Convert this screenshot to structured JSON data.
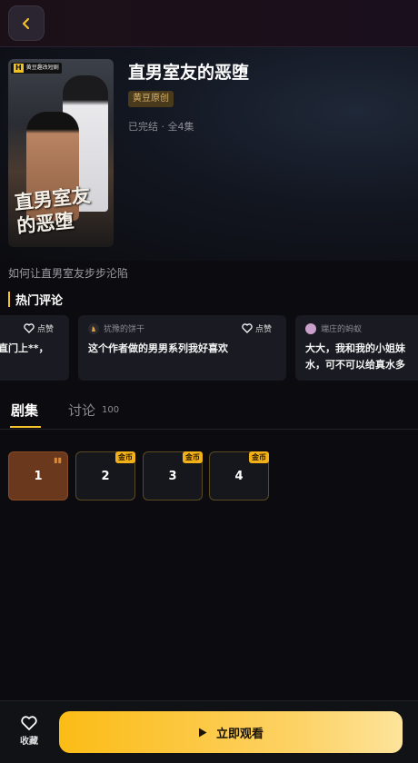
{
  "drama": {
    "title": "直男室友的恶堕",
    "tag": "黄豆原创",
    "status": "已完结 · 全4集",
    "description": "如何让直男室友步步沦陷",
    "poster": {
      "badge_letter": "H",
      "badge_text": "黄豆趣改短剧",
      "title_line1": "直男室友",
      "title_line2": "的恶堕"
    }
  },
  "comments_section": {
    "title": "热门评论",
    "comments": [
      {
        "user": "",
        "text": "直门上**，",
        "like_label": "点赞"
      },
      {
        "user": "犹豫的饼干",
        "text": "这个作者做的男男系列我好喜欢",
        "like_label": "点赞"
      },
      {
        "user": "端庄的蚂蚁",
        "text_line1": "大大，我和我的小姐妹",
        "text_line2": "水，可不可以给真水多"
      }
    ]
  },
  "tabs": {
    "episodes_label": "剧集",
    "discuss_label": "讨论",
    "discuss_count": "100"
  },
  "episodes": [
    {
      "number": "1",
      "coin": "",
      "playing": true
    },
    {
      "number": "2",
      "coin": "金币",
      "playing": false
    },
    {
      "number": "3",
      "coin": "金币",
      "playing": false
    },
    {
      "number": "4",
      "coin": "金币",
      "playing": false
    }
  ],
  "bottom": {
    "favorite_label": "收藏",
    "watch_label": "立即观看"
  },
  "colors": {
    "accent": "#f5c22c",
    "background": "#0c0c10",
    "card": "#1a1b22"
  }
}
